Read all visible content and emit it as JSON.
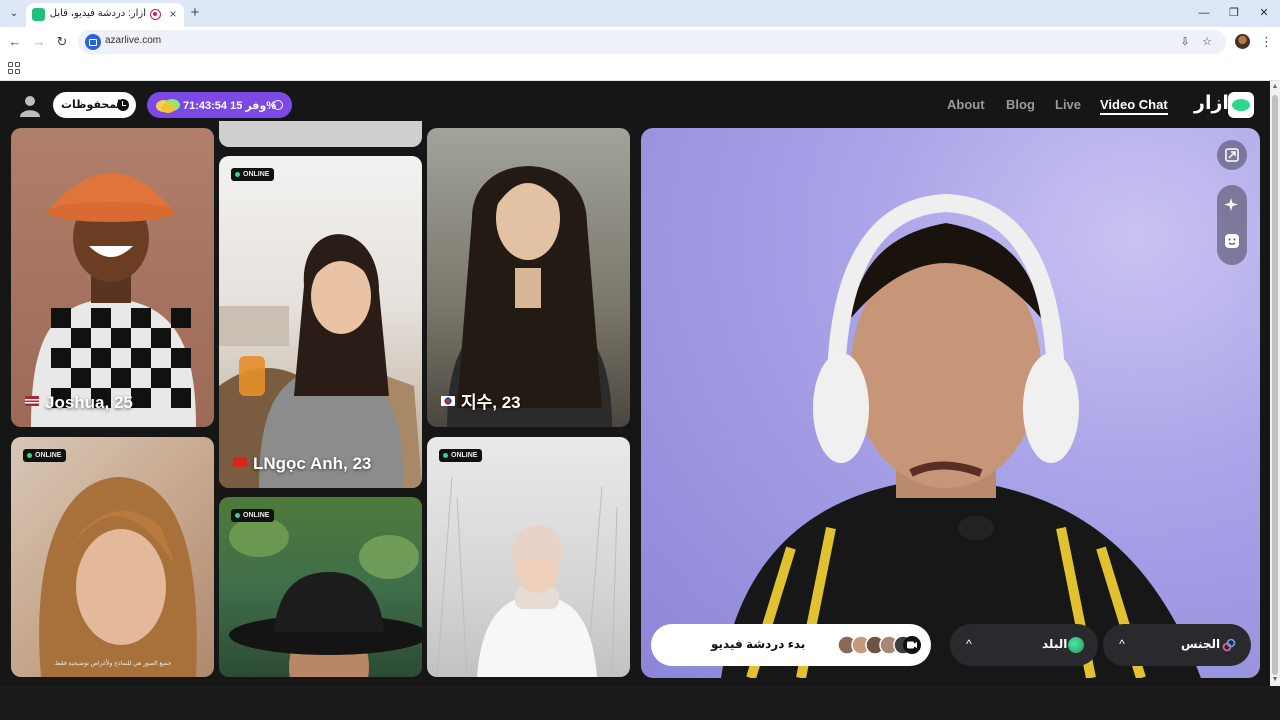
{
  "browser": {
    "tab_title": "أزار: دردشة فيديو، قابل الأصدقاء",
    "tab_close": "×",
    "new_tab": "+",
    "url": "azarlive.com",
    "win_minimize": "—",
    "win_restore": "❐",
    "win_close": "✕"
  },
  "header": {
    "saved_label": "المحفوظات",
    "promo_text": "71:43:54 وفر 15%",
    "nav": [
      "About",
      "Blog",
      "Live",
      "Video Chat"
    ],
    "active_nav": "Video Chat",
    "brand": "ازار"
  },
  "cards": {
    "online_label": "ONLINE",
    "joshua": "Joshua, 25",
    "ngoc": "LNgọc Anh, 23",
    "jisu": "지수, 23",
    "disclaimer": "جميع الصور هي للنماذج ولأغراض توضيحية فقط."
  },
  "video": {
    "start_label": "بدء دردشة فيديو",
    "country_label": "البلد",
    "gender_label": "الجنس",
    "chevron": "^"
  },
  "colors": {
    "accent_green": "#2cd88c",
    "promo_purple": "#7b4ae6"
  }
}
